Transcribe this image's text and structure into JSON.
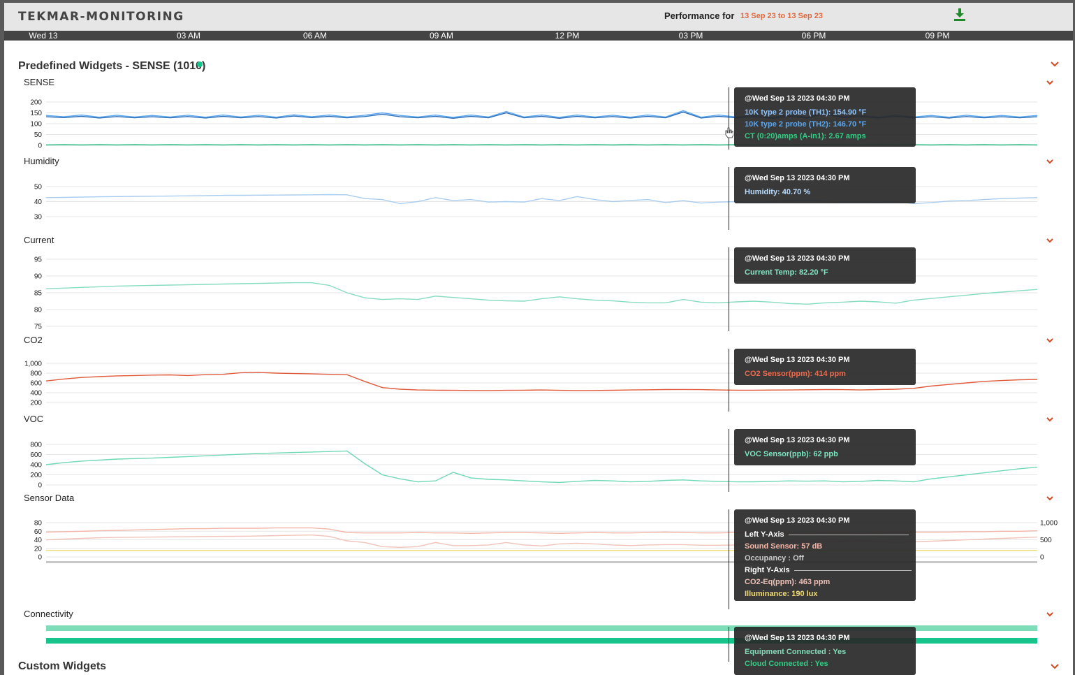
{
  "app": {
    "brand": "TEKMAR-MONITORING",
    "performance_label": "Performance for",
    "date_range": "13 Sep 23 to 13 Sep 23",
    "download_icon": "download-icon",
    "accent": "#e0683c"
  },
  "timeline": {
    "ticks": [
      "Wed 13",
      "03 AM",
      "06 AM",
      "09 AM",
      "12 PM",
      "03 PM",
      "06 PM",
      "09 PM"
    ]
  },
  "sections": {
    "predefined_title": "Predefined Widgets - SENSE (1010)",
    "status_color": "#17c58c",
    "custom_title": "Custom Widgets"
  },
  "widgets": {
    "sense": {
      "label": "SENSE",
      "tooltip": {
        "time": "@Wed Sep 13 2023 04:30 PM",
        "lines": [
          "10K type 2 probe (TH1): 154.90 °F",
          "10K type 2 probe (TH2): 146.70 °F",
          "CT (0:20)amps (A-in1): 2.67 amps"
        ]
      }
    },
    "humidity": {
      "label": "Humidity",
      "tooltip": {
        "time": "@Wed Sep 13 2023 04:30 PM",
        "lines": [
          "Humidity: 40.70 %"
        ]
      }
    },
    "current": {
      "label": "Current",
      "tooltip": {
        "time": "@Wed Sep 13 2023 04:30 PM",
        "lines": [
          "Current Temp: 82.20 °F"
        ]
      }
    },
    "co2": {
      "label": "CO2",
      "tooltip": {
        "time": "@Wed Sep 13 2023 04:30 PM",
        "lines": [
          "CO2 Sensor(ppm): 414 ppm"
        ]
      }
    },
    "voc": {
      "label": "VOC",
      "tooltip": {
        "time": "@Wed Sep 13 2023 04:30 PM",
        "lines": [
          "VOC Sensor(ppb): 62 ppb"
        ]
      }
    },
    "sensor_data": {
      "label": "Sensor Data",
      "tooltip": {
        "time": "@Wed Sep 13 2023 04:30 PM",
        "left_axis": "Left Y-Axis",
        "left_lines": [
          "Sound Sensor: 57 dB",
          "Occupancy : Off"
        ],
        "right_axis": "Right Y-Axis",
        "right_lines": [
          "CO2-Eq(ppm): 463 ppm",
          "Illuminance: 190 lux"
        ]
      }
    },
    "connectivity": {
      "label": "Connectivity",
      "tooltip": {
        "time": "@Wed Sep 13 2023 04:30 PM",
        "lines": [
          "Equipment Connected : Yes",
          "Cloud Connected : Yes"
        ]
      }
    }
  },
  "chart_data": [
    {
      "id": "sense",
      "type": "line",
      "yticks": [
        "200",
        "150",
        "100",
        "50",
        "0"
      ],
      "ylim": [
        0,
        200
      ],
      "series": [
        {
          "name": "10K type 2 probe (TH1)",
          "color": "#5aa7f0",
          "values": [
            138,
            132,
            140,
            130,
            139,
            131,
            138,
            131,
            139,
            130,
            140,
            131,
            139,
            130,
            141,
            132,
            140,
            131,
            139,
            150,
            138,
            131,
            140,
            129,
            140,
            131,
            156,
            131,
            140,
            129,
            140,
            131,
            139,
            130,
            140,
            131,
            160,
            130,
            140,
            131,
            139,
            129,
            140,
            130,
            155,
            132,
            139,
            130,
            140,
            131,
            138,
            130,
            139,
            131,
            138,
            131,
            138
          ]
        },
        {
          "name": "10K type 2 probe (TH2)",
          "color": "#2e6fb8",
          "values": [
            132,
            128,
            134,
            126,
            133,
            127,
            132,
            127,
            133,
            126,
            134,
            127,
            133,
            126,
            135,
            128,
            134,
            127,
            133,
            144,
            132,
            127,
            134,
            125,
            134,
            127,
            150,
            127,
            134,
            125,
            134,
            127,
            133,
            126,
            134,
            127,
            154,
            126,
            134,
            127,
            133,
            125,
            134,
            126,
            147,
            128,
            133,
            126,
            134,
            127,
            132,
            126,
            133,
            127,
            132,
            127,
            132
          ]
        },
        {
          "name": "CT (0:20)amps (A-in1)",
          "color": "#17b57a",
          "values": [
            2,
            3,
            2,
            3,
            2,
            3,
            2,
            3,
            2,
            3,
            2,
            3,
            2,
            3,
            2,
            3,
            2,
            3,
            2,
            3,
            2,
            3,
            2,
            3,
            2,
            3,
            2,
            3,
            2,
            3,
            2,
            3,
            2,
            3,
            2,
            3,
            2,
            3,
            2,
            3,
            2,
            3,
            2,
            3,
            3,
            3,
            2,
            3,
            2,
            3,
            2,
            3,
            2,
            3,
            2,
            3,
            2
          ]
        }
      ]
    },
    {
      "id": "humidity",
      "type": "line",
      "yticks": [
        "50",
        "40",
        "30"
      ],
      "ylim": [
        25,
        55
      ],
      "series": [
        {
          "name": "Humidity",
          "color": "#a9cdf0",
          "values": [
            44,
            44.2,
            44.5,
            44.8,
            45,
            45.2,
            45.4,
            45.5,
            45.7,
            46,
            46.2,
            46.3,
            46.4,
            46.5,
            46.6,
            46.8,
            47,
            46.8,
            43,
            42,
            38,
            40,
            44,
            41,
            42,
            39.5,
            40,
            39.5,
            43,
            41,
            45,
            42,
            40,
            41,
            42,
            39,
            41,
            38.5,
            39.5,
            40,
            39,
            40,
            40.7,
            41,
            40.5,
            39.8,
            40,
            39.2,
            40.2,
            38,
            39,
            40.5,
            41,
            42,
            43,
            43.5,
            44
          ]
        }
      ]
    },
    {
      "id": "current",
      "type": "line",
      "yticks": [
        "95",
        "90",
        "85",
        "80",
        "75"
      ],
      "ylim": [
        75,
        95
      ],
      "series": [
        {
          "name": "Current Temp",
          "color": "#86dcc0",
          "values": [
            86.2,
            86.4,
            86.6,
            86.8,
            87,
            87.1,
            87.2,
            87.3,
            87.4,
            87.5,
            87.6,
            87.7,
            87.8,
            87.9,
            88,
            88,
            87.2,
            85,
            83.5,
            83,
            83.2,
            83,
            84,
            83.6,
            83.2,
            82.8,
            82.6,
            82.5,
            83.2,
            83.8,
            83.2,
            82.8,
            82.6,
            82.2,
            82,
            82,
            83,
            82.2,
            82,
            82.3,
            82.5,
            82.2,
            81.8,
            81.6,
            82,
            82.2,
            82.5,
            82.3,
            81.9,
            82.8,
            83.3,
            83.8,
            84.3,
            84.8,
            85.2,
            85.6,
            86
          ]
        }
      ]
    },
    {
      "id": "co2",
      "type": "line",
      "yticks": [
        "1,000",
        "800",
        "600",
        "400",
        "200"
      ],
      "ylim": [
        100,
        1100
      ],
      "series": [
        {
          "name": "CO2 Sensor(ppm)",
          "color": "#e0593a",
          "values": [
            650,
            700,
            740,
            760,
            780,
            790,
            800,
            805,
            790,
            810,
            820,
            860,
            870,
            850,
            840,
            830,
            820,
            810,
            640,
            480,
            440,
            420,
            415,
            410,
            408,
            405,
            410,
            415,
            420,
            410,
            405,
            408,
            412,
            420,
            425,
            430,
            432,
            428,
            420,
            415,
            414,
            418,
            420,
            425,
            430,
            428,
            420,
            430,
            440,
            460,
            520,
            560,
            600,
            640,
            660,
            680,
            690
          ]
        }
      ]
    },
    {
      "id": "voc",
      "type": "line",
      "yticks": [
        "800",
        "600",
        "400",
        "200",
        "0"
      ],
      "ylim": [
        0,
        800
      ],
      "series": [
        {
          "name": "VOC Sensor(ppb)",
          "color": "#6ed9b2",
          "values": [
            400,
            440,
            470,
            490,
            510,
            520,
            530,
            545,
            560,
            575,
            590,
            605,
            620,
            630,
            640,
            650,
            660,
            670,
            420,
            200,
            120,
            60,
            80,
            250,
            140,
            110,
            100,
            80,
            60,
            50,
            70,
            90,
            80,
            60,
            70,
            90,
            100,
            80,
            70,
            60,
            62,
            70,
            80,
            75,
            80,
            60,
            70,
            90,
            80,
            60,
            120,
            160,
            200,
            240,
            280,
            320,
            350
          ]
        }
      ]
    },
    {
      "id": "sensor_data",
      "type": "line",
      "yticks_left": [
        "80",
        "60",
        "40",
        "20",
        "0"
      ],
      "ylim_left": [
        0,
        80
      ],
      "yticks_right": [
        "1,000",
        "500",
        "0"
      ],
      "ylim_right": [
        0,
        1000
      ],
      "series": [
        {
          "name": "Sound Sensor",
          "color": "#f4b4a6",
          "values": [
            58,
            59,
            60,
            61,
            62,
            63,
            64,
            65,
            66,
            66,
            67,
            67,
            67,
            68,
            68,
            68,
            65,
            57,
            56,
            56,
            56,
            57,
            56,
            56,
            55,
            56,
            57,
            57,
            56,
            55,
            56,
            57,
            56,
            56,
            57,
            58,
            57,
            56,
            56,
            57,
            57,
            56,
            56,
            55,
            56,
            56,
            55,
            56,
            57,
            58,
            58,
            58,
            59,
            59,
            60,
            60,
            61
          ]
        },
        {
          "name": "CO2-Eq(ppm)",
          "color": "#f0c2b8",
          "values": [
            500,
            520,
            540,
            560,
            570,
            575,
            580,
            585,
            590,
            595,
            600,
            605,
            610,
            620,
            630,
            640,
            600,
            470,
            420,
            300,
            280,
            300,
            420,
            330,
            330,
            350,
            420,
            350,
            320,
            380,
            400,
            380,
            350,
            330,
            350,
            360,
            360,
            340,
            340,
            350,
            463,
            470,
            460,
            450,
            440,
            450,
            460,
            440,
            430,
            440,
            460,
            480,
            500,
            520,
            540,
            560,
            580
          ]
        },
        {
          "name": "Illuminance",
          "color": "#f1dc7a",
          "values": [
            190,
            190,
            190,
            190,
            190,
            190,
            190,
            190,
            190,
            190,
            190,
            190,
            190,
            190,
            190,
            190,
            190,
            190,
            190,
            190,
            190,
            190,
            190,
            190,
            190,
            190,
            190,
            190,
            190,
            190,
            190,
            190,
            190,
            190,
            190,
            190,
            190,
            190,
            190,
            190,
            190,
            190,
            190,
            190,
            190,
            190,
            190,
            190,
            190,
            190,
            190,
            190,
            190,
            190,
            190,
            190,
            190
          ]
        }
      ]
    },
    {
      "id": "connectivity",
      "type": "area",
      "series": [
        {
          "name": "Equipment Connected",
          "color": "#7fdcb8",
          "values": [
            1
          ]
        },
        {
          "name": "Cloud Connected",
          "color": "#17c58c",
          "values": [
            1
          ]
        }
      ]
    }
  ]
}
